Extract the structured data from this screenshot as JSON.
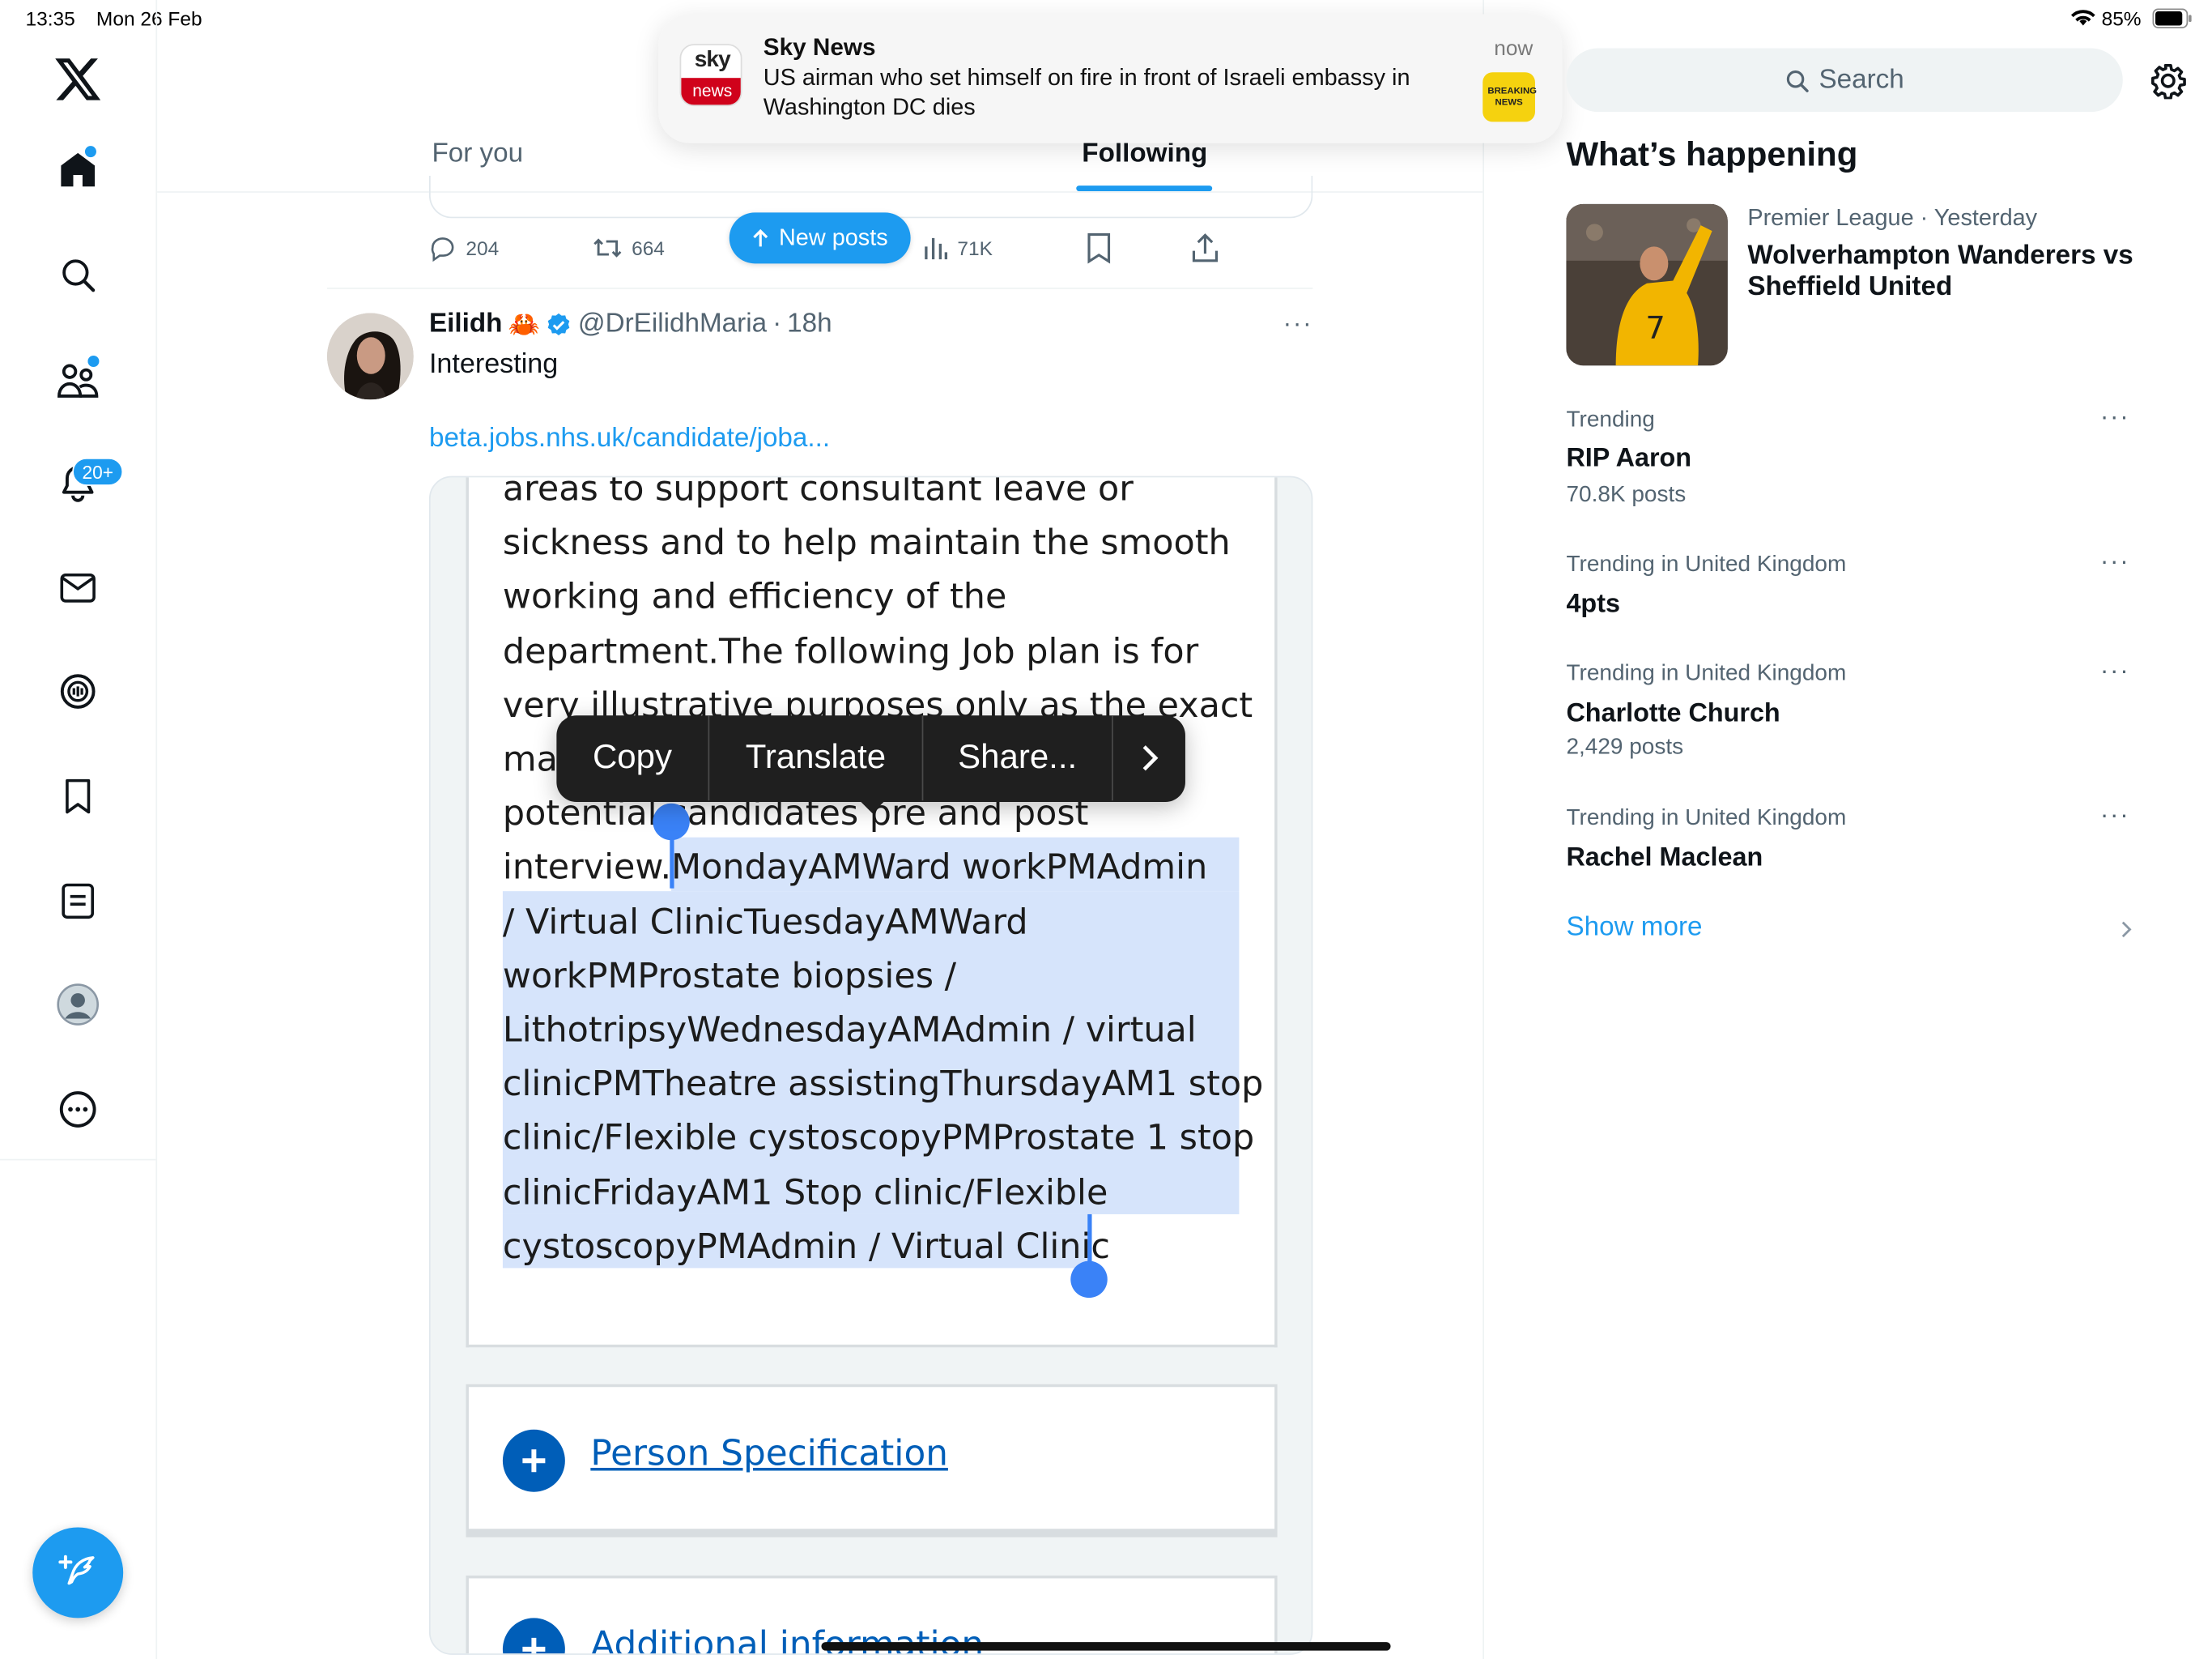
{
  "status_bar": {
    "time": "13:35",
    "date": "Mon 26 Feb",
    "battery": "85%"
  },
  "notification": {
    "app": "Sky News",
    "logo_top": "sky",
    "logo_bottom": "news",
    "time": "now",
    "text_line1": "US airman who set himself on fire in front of Israeli embassy in",
    "text_line2": "Washington DC dies",
    "thumb_text": "BREAKING NEWS"
  },
  "sidebar": {
    "notifications_badge": "20+",
    "items": [
      "x-logo",
      "home",
      "explore",
      "communities",
      "notifications",
      "messages",
      "spaces",
      "bookmarks",
      "lists",
      "profile",
      "more"
    ]
  },
  "tabs": {
    "for_you": "For you",
    "following": "Following"
  },
  "prev_tweet": {
    "replies": "204",
    "retweets": "664",
    "views": "71K"
  },
  "new_posts": "New posts",
  "tweet": {
    "name": "Eilidh",
    "name_emoji": "🦀",
    "handle": "@DrEilidhMaria",
    "sep": "·",
    "time": "18h",
    "text": "Interesting",
    "link": "beta.jobs.nhs.uk/candidate/joba...",
    "more": "···"
  },
  "doc": {
    "lines": [
      "areas to support consultant leave or",
      "sickness and to help maintain the smooth",
      "working and efficiency of the",
      "department.The following Job plan is for",
      "very illustrative purposes only as the exact",
      "ma",
      "potential candidates pre and post",
      "interview.MondayAMWard workPMAdmin",
      "/ Virtual ClinicTuesdayAMWard",
      "workPMProstate biopsies /",
      "LithotripsyWednesdayAMAdmin / virtual",
      "clinicPMTheatre assistingThursdayAM1 stop",
      "clinic/Flexible cystoscopyPMProstate 1 stop",
      "clinicFridayAM1 Stop clinic/Flexible",
      "cystoscopyPMAdmin / Virtual Clinic"
    ],
    "section1": "Person Specification",
    "section2": "Additional information"
  },
  "context_menu": {
    "copy": "Copy",
    "translate": "Translate",
    "share": "Share..."
  },
  "search": {
    "placeholder": "Search"
  },
  "whats_happening": {
    "title": "What’s happening",
    "featured": {
      "category": "Premier League",
      "sep": " · ",
      "when": "Yesterday",
      "title": "Wolverhampton Wanderers vs Sheffield United"
    },
    "trends": [
      {
        "context": "Trending",
        "title": "RIP Aaron",
        "count": "70.8K posts"
      },
      {
        "context": "Trending in United Kingdom",
        "title": "4pts",
        "count": ""
      },
      {
        "context": "Trending in United Kingdom",
        "title": "Charlotte Church",
        "count": "2,429 posts"
      },
      {
        "context": "Trending in United Kingdom",
        "title": "Rachel Maclean",
        "count": ""
      }
    ],
    "show_more": "Show more"
  },
  "colors": {
    "accent": "#1d9bf0",
    "selection": "#d6e4fb",
    "handle": "#3a82f7",
    "nhs_blue": "#005eb8"
  }
}
